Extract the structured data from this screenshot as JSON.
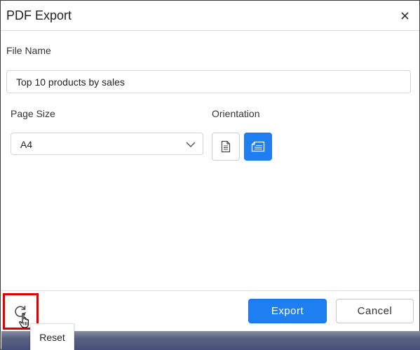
{
  "dialog": {
    "title": "PDF Export",
    "close_icon": "close-icon"
  },
  "file_name": {
    "label": "File Name",
    "value": "Top 10 products by sales"
  },
  "page_size": {
    "label": "Page Size",
    "selected": "A4",
    "icon": "chevron-down-icon"
  },
  "orientation": {
    "label": "Orientation",
    "options": [
      {
        "name": "portrait",
        "icon": "portrait-page-icon",
        "selected": false
      },
      {
        "name": "landscape",
        "icon": "landscape-page-icon",
        "selected": true
      }
    ]
  },
  "footer": {
    "export_label": "Export",
    "cancel_label": "Cancel",
    "reset_icon": "reset-icon",
    "reset_tooltip": "Reset"
  },
  "colors": {
    "accent": "#1f7ff0",
    "highlight": "#e00000"
  }
}
